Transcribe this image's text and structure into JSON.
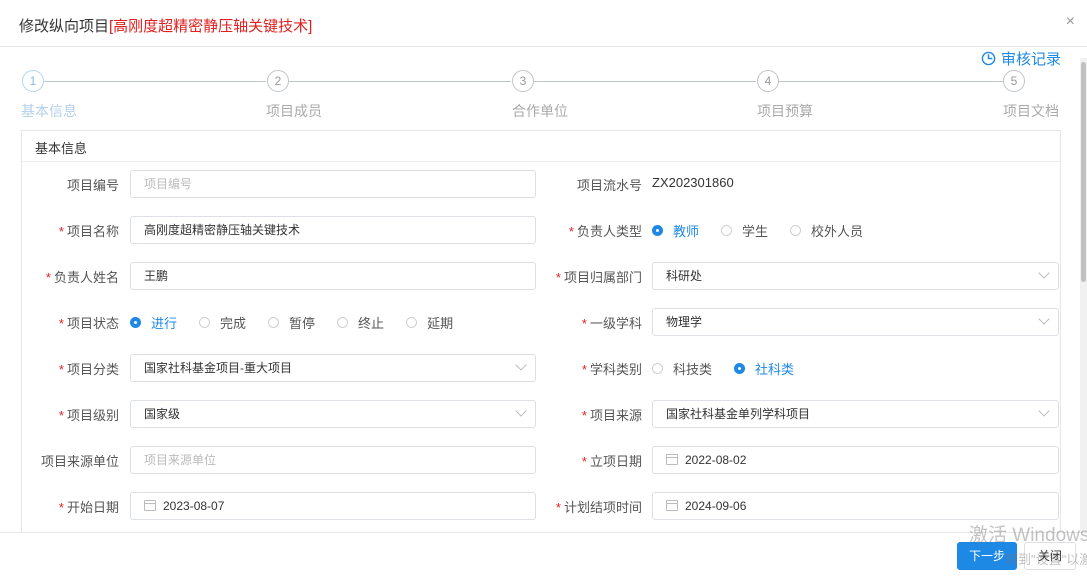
{
  "dialog": {
    "title_prefix": "修改纵向项目",
    "title_project": "[高刚度超精密静压轴关键技术]",
    "close_glyph": "×",
    "audit_label": "审核记录"
  },
  "steps": [
    {
      "num": "1",
      "label": "基本信息",
      "active": true
    },
    {
      "num": "2",
      "label": "项目成员",
      "active": false
    },
    {
      "num": "3",
      "label": "合作单位",
      "active": false
    },
    {
      "num": "4",
      "label": "项目预算",
      "active": false
    },
    {
      "num": "5",
      "label": "项目文档",
      "active": false
    }
  ],
  "panel": {
    "title": "基本信息"
  },
  "form": {
    "project_no": {
      "label": "项目编号",
      "placeholder": "项目编号"
    },
    "serial_no": {
      "label": "项目流水号",
      "value": "ZX202301860"
    },
    "project_name": {
      "label": "项目名称",
      "value": "高刚度超精密静压轴关键技术"
    },
    "leader_type": {
      "label": "负责人类型",
      "options": [
        "教师",
        "学生",
        "校外人员"
      ],
      "selected": "教师"
    },
    "leader_name": {
      "label": "负责人姓名",
      "value": "王鹏"
    },
    "department": {
      "label": "项目归属部门",
      "value": "科研处"
    },
    "status": {
      "label": "项目状态",
      "options": [
        "进行",
        "完成",
        "暂停",
        "终止",
        "延期"
      ],
      "selected": "进行"
    },
    "discipline": {
      "label": "一级学科",
      "value": "物理学"
    },
    "category": {
      "label": "项目分类",
      "value": "国家社科基金项目-重大项目"
    },
    "subject_type": {
      "label": "学科类别",
      "options": [
        "科技类",
        "社科类"
      ],
      "selected": "社科类"
    },
    "level": {
      "label": "项目级别",
      "value": "国家级"
    },
    "source": {
      "label": "项目来源",
      "value": "国家社科基金单列学科项目"
    },
    "source_unit": {
      "label": "项目来源单位",
      "placeholder": "项目来源单位"
    },
    "setup_date": {
      "label": "立项日期",
      "value": "2022-08-02"
    },
    "start_date": {
      "label": "开始日期",
      "value": "2023-08-07"
    },
    "end_date": {
      "label": "计划结项时间",
      "value": "2024-09-06"
    }
  },
  "footer": {
    "next_label": "下一步",
    "close_label": "关闭"
  },
  "watermark": {
    "line1": "激活 Windows",
    "line2": "转到\"设置\"以激活"
  },
  "colors": {
    "primary": "#1e88e5",
    "required": "#e02020",
    "title_project": "#e02020"
  }
}
